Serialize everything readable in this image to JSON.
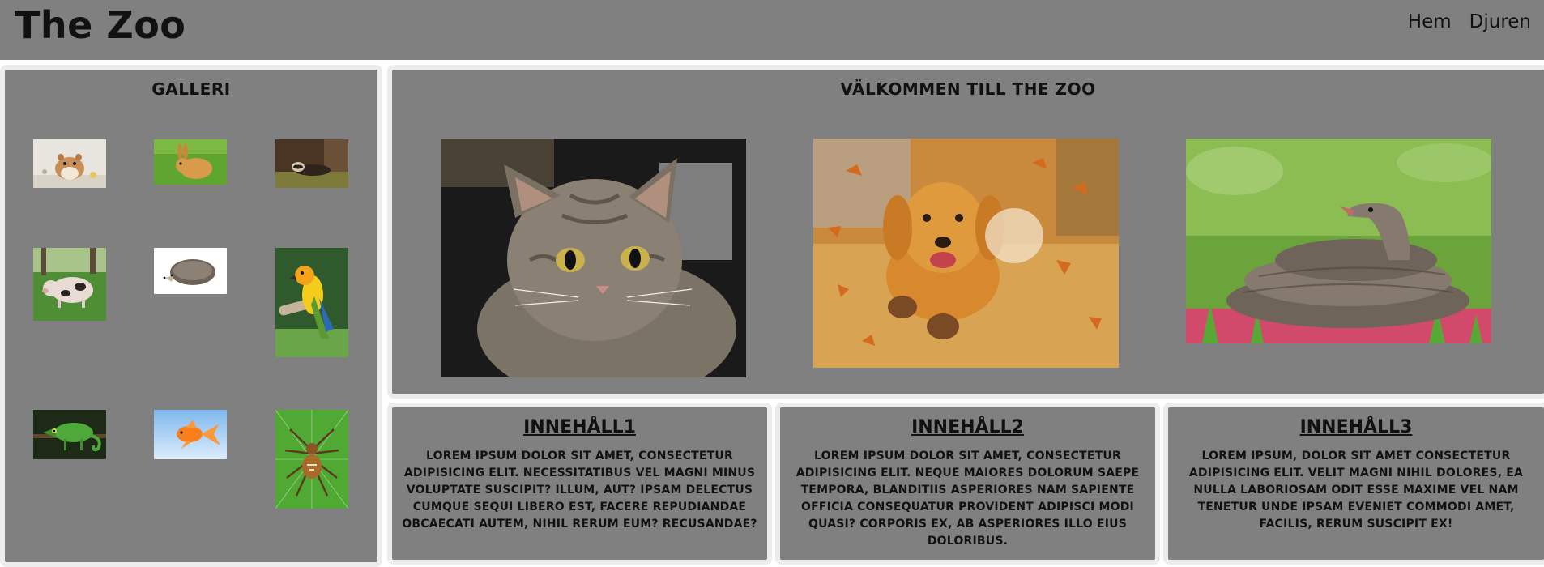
{
  "header": {
    "site_title": "The Zoo",
    "nav": [
      {
        "label": "Hem"
      },
      {
        "label": "Djuren"
      }
    ]
  },
  "gallery": {
    "title": "GALLERI",
    "thumbnails": [
      {
        "icon": "hamster-image"
      },
      {
        "icon": "rabbit-image"
      },
      {
        "icon": "ferret-image"
      },
      {
        "icon": "pig-image"
      },
      {
        "icon": "hedgehog-image"
      },
      {
        "icon": "parrot-image"
      },
      {
        "icon": "chameleon-image"
      },
      {
        "icon": "goldfish-image"
      },
      {
        "icon": "spider-image"
      }
    ]
  },
  "welcome": {
    "title": "VÄLKOMMEN TILL THE ZOO",
    "images": [
      {
        "icon": "cat-image"
      },
      {
        "icon": "dog-image"
      },
      {
        "icon": "snake-image"
      }
    ]
  },
  "content": [
    {
      "title": "INNEHÅLL1",
      "text": "Lorem ipsum dolor sit amet, consectetur adipisicing elit. Necessitatibus vel magni minus voluptate suscipit? Illum, aut? Ipsam delectus cumque sequi libero est, facere repudiandae obcaecati autem, nihil rerum eum? Recusandae?"
    },
    {
      "title": "INNEHÅLL2",
      "text": "Lorem ipsum dolor sit amet, consectetur adipisicing elit. Neque maiores dolorum saepe tempora, blanditiis asperiores nam sapiente officia consequatur provident adipisci modi quasi? Corporis ex, ab asperiores illo eius doloribus."
    },
    {
      "title": "INNEHÅLL3",
      "text": "Lorem ipsum, dolor sit amet consectetur adipisicing elit. Velit magni nihil dolores, ea nulla laboriosam odit esse maxime vel nam tenetur unde ipsam eveniet commodi amet, facilis, rerum suscipit ex!"
    }
  ],
  "colors": {
    "panel_background": "#808080",
    "panel_border": "#ececec",
    "text": "#111111"
  }
}
